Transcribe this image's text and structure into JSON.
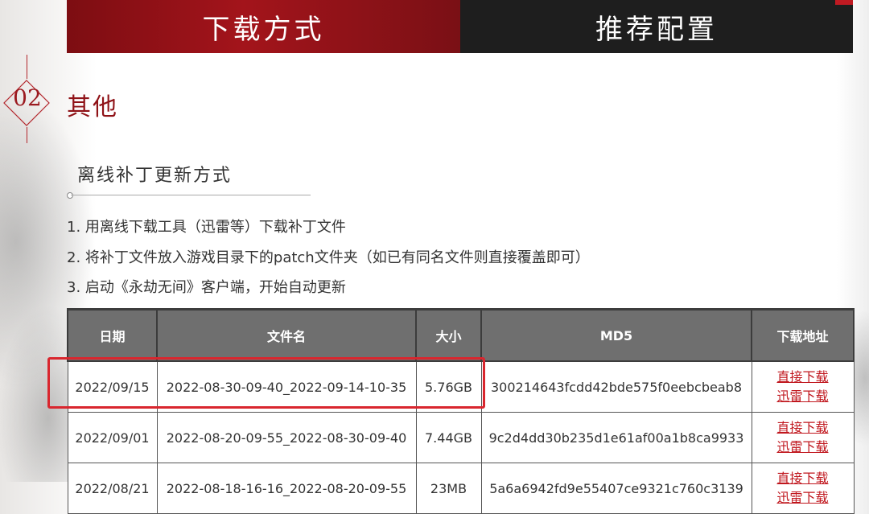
{
  "tabs": [
    {
      "label": "下载方式"
    },
    {
      "label": "推荐配置"
    }
  ],
  "section": {
    "number": "02",
    "title": "其他"
  },
  "subsection": {
    "title": "离线补丁更新方式"
  },
  "steps": [
    "1. 用离线下载工具（迅雷等）下载补丁文件",
    "2. 将补丁文件放入游戏目录下的patch文件夹（如已有同名文件则直接覆盖即可）",
    "3. 启动《永劫无间》客户端，开始自动更新"
  ],
  "table": {
    "headers": [
      "日期",
      "文件名",
      "大小",
      "MD5",
      "下载地址"
    ],
    "rows": [
      {
        "date": "2022/09/15",
        "file": "2022-08-30-09-40_2022-09-14-10-35",
        "size": "5.76GB",
        "md5": "300214643fcdd42bde575f0eebcbeab8",
        "link1": "直接下载",
        "link2": "迅雷下载"
      },
      {
        "date": "2022/09/01",
        "file": "2022-08-20-09-55_2022-08-30-09-40",
        "size": "7.44GB",
        "md5": "9c2d4dd30b235d1e61af00a1b8ca9933",
        "link1": "直接下载",
        "link2": "迅雷下载"
      },
      {
        "date": "2022/08/21",
        "file": "2022-08-18-16-16_2022-08-20-09-55",
        "size": "23MB",
        "md5": "5a6a6942fd9e55407ce9321c760c3139",
        "link1": "直接下载",
        "link2": "迅雷下载"
      }
    ]
  },
  "colors": {
    "accent": "#a3141b",
    "link": "#c0161d",
    "header_bg": "#6f6f6f"
  }
}
